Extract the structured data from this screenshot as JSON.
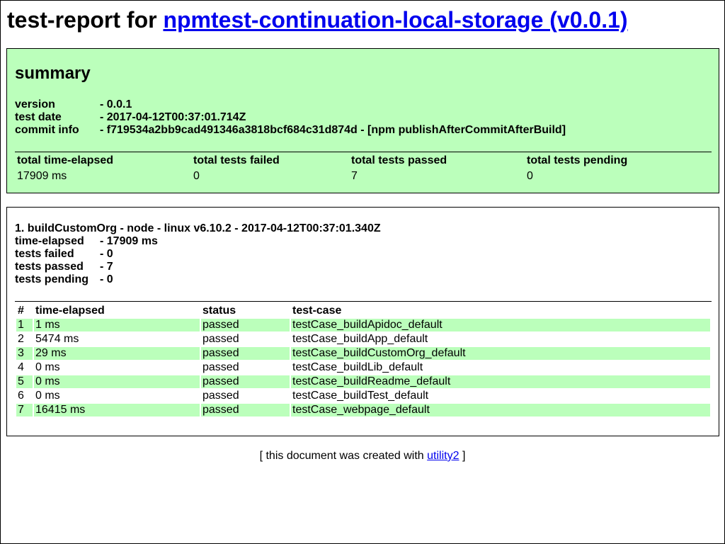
{
  "header": {
    "title_prefix": "test-report for ",
    "title_link": "npmtest-continuation-local-storage (v0.0.1)"
  },
  "summary": {
    "heading": "summary",
    "info": [
      {
        "key": "version",
        "value": "- 0.0.1"
      },
      {
        "key": "test date",
        "value": "- 2017-04-12T00:37:01.714Z"
      },
      {
        "key": "commit info",
        "value": "- f719534a2bb9cad491346a3818bcf684c31d874d - [npm publishAfterCommitAfterBuild]"
      }
    ],
    "stats": [
      {
        "label": "total time-elapsed",
        "value": "17909 ms"
      },
      {
        "label": "total tests failed",
        "value": "0"
      },
      {
        "label": "total tests passed",
        "value": "7"
      },
      {
        "label": "total tests pending",
        "value": "0"
      }
    ]
  },
  "testrun": {
    "title": "1. buildCustomOrg - node - linux v6.10.2 - 2017-04-12T00:37:01.340Z",
    "info": [
      {
        "key": "time-elapsed",
        "value": "- 17909 ms"
      },
      {
        "key": "tests failed",
        "value": "- 0"
      },
      {
        "key": "tests passed",
        "value": "- 7"
      },
      {
        "key": "tests pending",
        "value": "- 0"
      }
    ],
    "columns": [
      "#",
      "time-elapsed",
      "status",
      "test-case"
    ],
    "rows": [
      [
        "1",
        "1 ms",
        "passed",
        "testCase_buildApidoc_default"
      ],
      [
        "2",
        "5474 ms",
        "passed",
        "testCase_buildApp_default"
      ],
      [
        "3",
        "29 ms",
        "passed",
        "testCase_buildCustomOrg_default"
      ],
      [
        "4",
        "0 ms",
        "passed",
        "testCase_buildLib_default"
      ],
      [
        "5",
        "0 ms",
        "passed",
        "testCase_buildReadme_default"
      ],
      [
        "6",
        "0 ms",
        "passed",
        "testCase_buildTest_default"
      ],
      [
        "7",
        "16415 ms",
        "passed",
        "testCase_webpage_default"
      ]
    ]
  },
  "footer": {
    "prefix": "[ this document was created with ",
    "link": "utility2",
    "suffix": " ]"
  },
  "colors": {
    "highlight": "#bbffbb",
    "link": "#0000ee"
  }
}
